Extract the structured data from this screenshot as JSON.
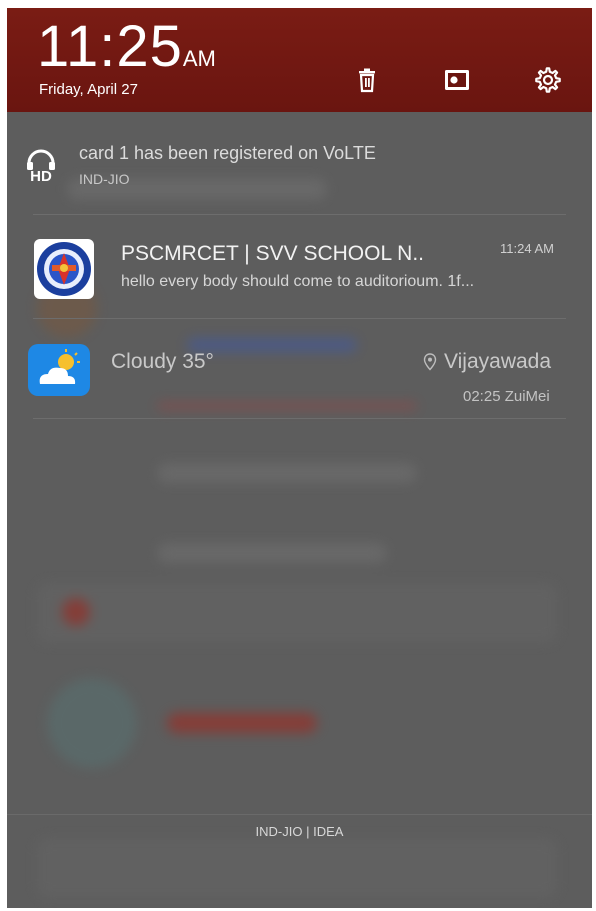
{
  "header": {
    "time": "11:25",
    "ampm": "AM",
    "date": "Friday, April 27",
    "icons": [
      "trash-icon",
      "screenshot-icon",
      "settings-icon"
    ]
  },
  "notifications": [
    {
      "icon": "hd-volte-icon",
      "title": "card 1 has been registered on VoLTE",
      "subtitle": "IND-JIO"
    },
    {
      "icon": "school-logo-icon",
      "title": "PSCMRCET | SVV SCHOOL N..",
      "time": "11:24 AM",
      "body": "hello every body should come to auditorioum. 1f..."
    },
    {
      "icon": "weather-cloudy-icon",
      "condition": "Cloudy 35°",
      "location": "Vijayawada",
      "updated": "02:25 ZuiMei"
    }
  ],
  "footer": {
    "carrier": "IND-JIO | IDEA"
  },
  "colors": {
    "header_bg": "#7a1c14",
    "shade_bg": "#5d5d5d",
    "weather_icon_bg": "#1e88e5"
  }
}
